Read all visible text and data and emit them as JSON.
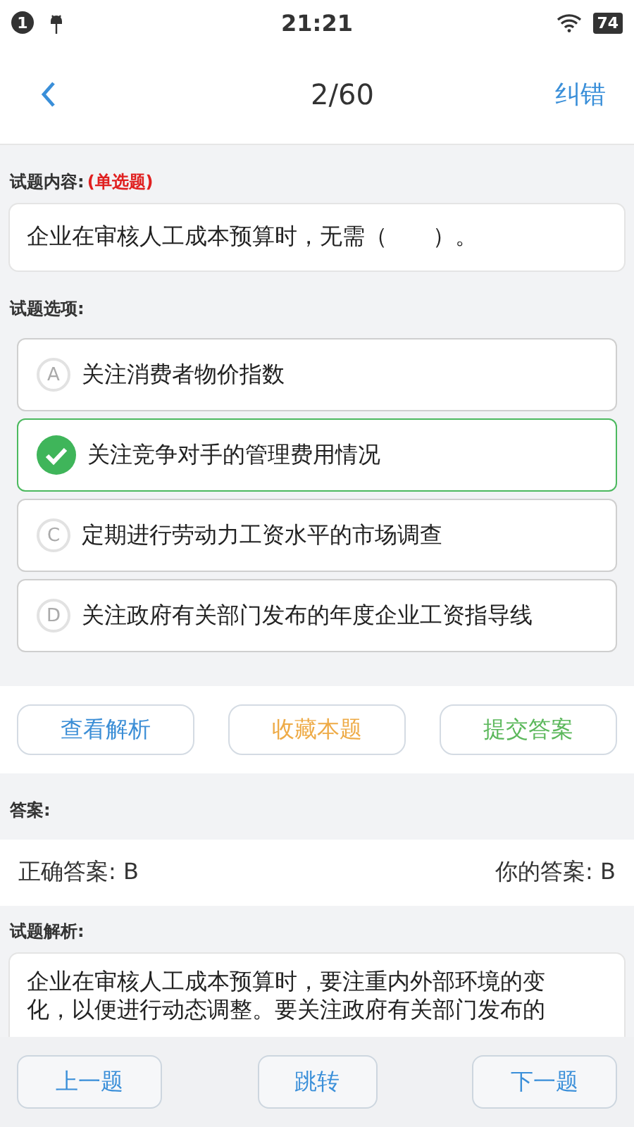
{
  "status_bar": {
    "notification_count": "1",
    "time": "21:21",
    "battery": "74"
  },
  "nav": {
    "title": "2/60",
    "action": "纠错"
  },
  "question": {
    "label": "试题内容:",
    "type": "(单选题)",
    "text": "企业在审核人工成本预算时，无需（　　）。"
  },
  "options_label": "试题选项:",
  "options": [
    {
      "letter": "A",
      "text": "关注消费者物价指数",
      "selected": false
    },
    {
      "text": "关注竞争对手的管理费用情况",
      "selected": true
    },
    {
      "letter": "C",
      "text": "定期进行劳动力工资水平的市场调查",
      "selected": false
    },
    {
      "letter": "D",
      "text": "关注政府有关部门发布的年度企业工资指导线",
      "selected": false
    }
  ],
  "actions": [
    {
      "label": "查看解析",
      "color": "#3b8ed6"
    },
    {
      "label": "收藏本题",
      "color": "#eeab47"
    },
    {
      "label": "提交答案",
      "color": "#5cb85c"
    }
  ],
  "answer": {
    "label": "答案:",
    "correct": "正确答案: B",
    "yours": "你的答案: B"
  },
  "analysis": {
    "label": "试题解析:",
    "lines": [
      "企业在审核人工成本预算时，要注重内外部环境的变",
      "化，以便进行动态调整。要关注政府有关部门发布的"
    ]
  },
  "bottom_buttons": [
    "上一题",
    "跳转",
    "下一题"
  ]
}
